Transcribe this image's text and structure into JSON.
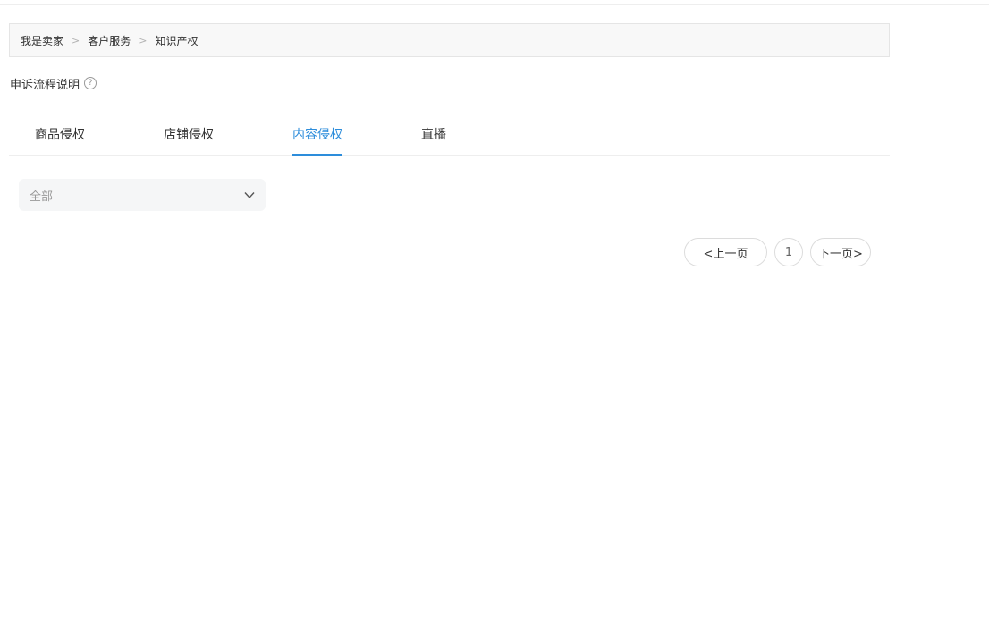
{
  "breadcrumb": {
    "items": [
      "我是卖家",
      "客户服务",
      "知识产权"
    ],
    "separator": ">"
  },
  "process": {
    "label": "申诉流程说明",
    "help_glyph": "?",
    "help_icon": "question-circle-icon"
  },
  "tabs": [
    {
      "label": "商品侵权",
      "active": false
    },
    {
      "label": "店铺侵权",
      "active": false
    },
    {
      "label": "内容侵权",
      "active": true
    },
    {
      "label": "直播",
      "active": false
    }
  ],
  "filter": {
    "selected": "全部",
    "icon": "chevron-down-icon"
  },
  "pagination": {
    "prev_label": "<上一页",
    "page": "1",
    "next_label": "下一页>"
  },
  "colors": {
    "accent": "#2d8ddb",
    "breadcrumb_bg": "#f8f8f8",
    "select_bg": "#f5f6f7"
  }
}
